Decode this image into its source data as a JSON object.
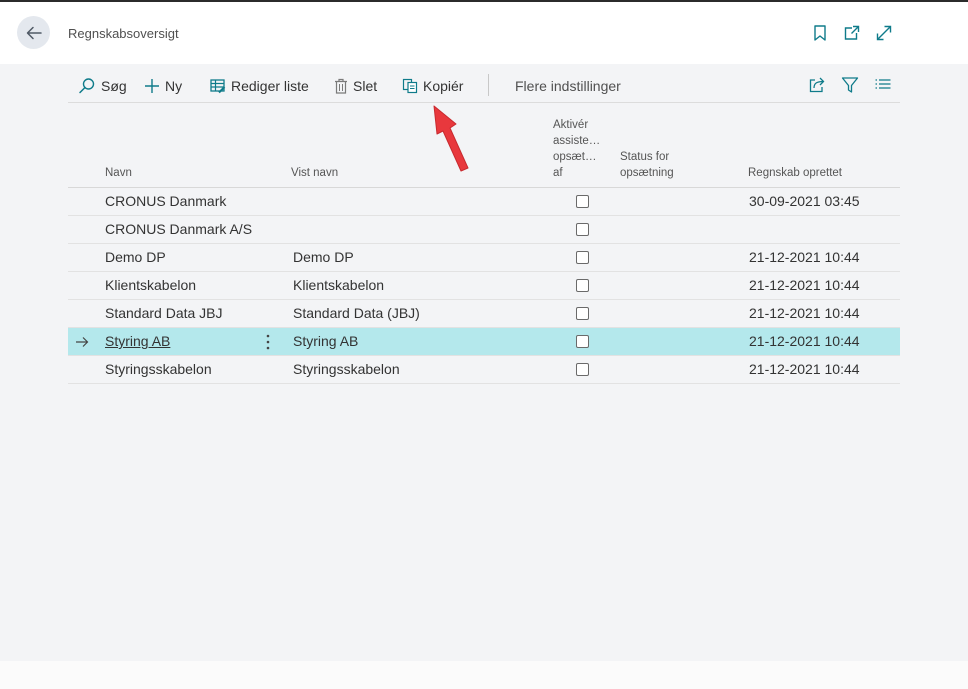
{
  "header": {
    "title": "Regnskabsoversigt",
    "icons": [
      "back-arrow-icon",
      "bookmark-icon",
      "open-new-window-icon",
      "expand-icon"
    ]
  },
  "toolbar": {
    "search_label": "Søg",
    "new_label": "Ny",
    "edit_list_label": "Rediger liste",
    "delete_label": "Slet",
    "copy_label": "Kopiér",
    "more_options_label": "Flere indstillinger",
    "right_icons": [
      "share-icon",
      "filter-icon",
      "list-view-icon"
    ]
  },
  "columns": {
    "name": "Navn",
    "display_name": "Vist navn",
    "activate_line1": "Aktivér",
    "activate_line2": "assiste…",
    "activate_line3": "opsæt…",
    "activate_line4": "af",
    "status_line1": "Status for",
    "status_line2": "opsætning",
    "created": "Regnskab oprettet"
  },
  "rows": [
    {
      "name": "CRONUS Danmark",
      "display_name": "",
      "created": "30-09-2021 03:45",
      "checked": false
    },
    {
      "name": "CRONUS Danmark A/S",
      "display_name": "",
      "created": "",
      "checked": false
    },
    {
      "name": "Demo DP",
      "display_name": "Demo DP",
      "created": "21-12-2021 10:44",
      "checked": false
    },
    {
      "name": "Klientskabelon",
      "display_name": "Klientskabelon",
      "created": "21-12-2021 10:44",
      "checked": false
    },
    {
      "name": "Standard Data JBJ",
      "display_name": "Standard Data (JBJ)",
      "created": "21-12-2021 10:44",
      "checked": false
    },
    {
      "name": "Styring AB",
      "display_name": "Styring AB",
      "created": "21-12-2021 10:44",
      "checked": false,
      "selected": true
    },
    {
      "name": "Styringsskabelon",
      "display_name": "Styringsskabelon",
      "created": "21-12-2021 10:44",
      "checked": false
    }
  ],
  "colors": {
    "selected_row": "#b4e8ec",
    "accent": "#0f7b8a",
    "annotation_arrow": "#e8383d"
  }
}
